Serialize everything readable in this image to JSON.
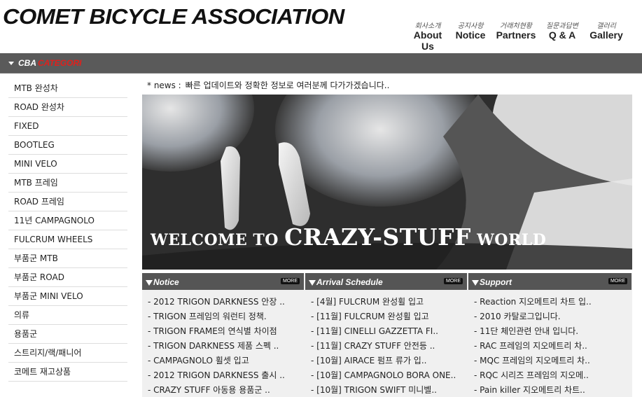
{
  "header": {
    "logo": "COMET BICYCLE ASSOCIATION",
    "nav": [
      {
        "ko": "회사소개",
        "en": "About Us"
      },
      {
        "ko": "공지사항",
        "en": "Notice"
      },
      {
        "ko": "거래처현황",
        "en": "Partners"
      },
      {
        "ko": "질문과답변",
        "en": "Q & A"
      },
      {
        "ko": "갤러리",
        "en": "Gallery"
      }
    ]
  },
  "category_bar": {
    "cba": "CBA",
    "category": "CATEGORI"
  },
  "sidebar": {
    "items": [
      "MTB 완성차",
      "ROAD 완성차",
      "FIXED",
      "BOOTLEG",
      "MINI VELO",
      "MTB 프레임",
      "ROAD 프레임",
      "11년 CAMPAGNOLO",
      "FULCRUM WHEELS",
      "부품군 MTB",
      "부품군 ROAD",
      "부품군 MINI VELO",
      "의류",
      "용품군",
      "스트리지/랙/패니어",
      "코메트 재고상품"
    ]
  },
  "news": {
    "label": "* news :",
    "text": "빠른 업데이트와 정확한 정보로 여러분께 다가가겠습니다.."
  },
  "banner": {
    "welcome_small1": "WELCOME TO ",
    "welcome_large": "CRAZY-STUFF",
    "welcome_small2": " WORLD"
  },
  "boxes": [
    {
      "title": "Notice",
      "more": "MORE",
      "items": [
        "- 2012 TRIGON DARKNESS 안장 ..",
        "- TRIGON 프레임의 워런티 정책.",
        "- TRIGON FRAME의 연식별 차이점",
        "- TRIGON DARKNESS 제품 스펙 ..",
        "- CAMPAGNOLO 휠셋 입고",
        "- 2012 TRIGON DARKNESS 출시 ..",
        "- CRAZY STUFF 아동용 용품군 .."
      ]
    },
    {
      "title": "Arrival Schedule",
      "more": "MORE",
      "items": [
        "- [4월] FULCRUM 완성휠 입고",
        "- [11월] FULCRUM 완성휠 입고",
        "- [11월] CINELLI GAZZETTA FI..",
        "- [11월] CRAZY STUFF 안전등 ..",
        "- [10월] AIRACE 펌프 류가 입..",
        "- [10월] CAMPAGNOLO BORA ONE..",
        "- [10월] TRIGON SWIFT 미니벨.."
      ]
    },
    {
      "title": "Support",
      "more": "MORE",
      "items": [
        "- Reaction 지오메트리 차트 입..",
        "- 2010 카탈로그입니다.",
        "- 11단 체인관련 안내 입니다.",
        "- RAC 프레임의 지오메트리 차..",
        "- MQC 프레임의 지오메트리 차..",
        "- RQC 시리즈 프레임의 지오메..",
        "- Pain killer 지오메트리 차트.."
      ]
    }
  ]
}
